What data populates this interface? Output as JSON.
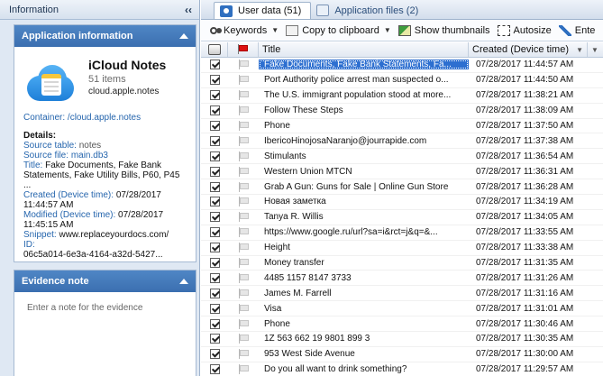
{
  "sidebar": {
    "header": "Information",
    "collapse_glyph": "‹‹",
    "app_panel_title": "Application information",
    "app_name": "iCloud Notes",
    "app_count": "51 items",
    "app_bundle": "cloud.apple.notes",
    "container_label": "Container:",
    "container_value": "/cloud.apple.notes",
    "details_heading": "Details:",
    "source_table_label": "Source table:",
    "source_table_value": "notes",
    "source_file_label": "Source file:",
    "source_file_value": "main.db3",
    "title_label": "Title:",
    "title_value": "Fake Documents, Fake Bank Statements, Fake Utility Bills, P60, P45 ...",
    "created_label": "Created (Device time):",
    "created_value": "07/28/2017 11:44:57 AM",
    "modified_label": "Modified (Device time):",
    "modified_value": "07/28/2017 11:45:15 AM",
    "snippet_label": "Snippet:",
    "snippet_value": "www.replaceyourdocs.com/",
    "id_label": "ID:",
    "id_value": "06c5a014-6e3a-4164-a32d-5427...",
    "evidence_title": "Evidence note",
    "evidence_placeholder": "Enter a note for the evidence"
  },
  "tabs": [
    {
      "label": "User data (51)",
      "active": true
    },
    {
      "label": "Application files (2)",
      "active": false
    }
  ],
  "toolbar": {
    "keywords": "Keywords",
    "copy": "Copy to clipboard",
    "thumbnails": "Show thumbnails",
    "autosize": "Autosize",
    "enter": "Ente"
  },
  "table": {
    "col_title": "Title",
    "col_created": "Created (Device time)",
    "rows": [
      {
        "title": "Fake Documents, Fake Bank Statements, Fa...",
        "created": "07/28/2017 11:44:57 AM",
        "selected": true
      },
      {
        "title": "Port Authority police arrest man suspected o...",
        "created": "07/28/2017 11:44:50 AM"
      },
      {
        "title": "The U.S. immigrant population stood at more...",
        "created": "07/28/2017 11:38:21 AM"
      },
      {
        "title": "Follow These Steps",
        "created": "07/28/2017 11:38:09 AM"
      },
      {
        "title": "Phone",
        "created": "07/28/2017 11:37:50 AM"
      },
      {
        "title": "IbericoHinojosaNaranjo@jourrapide.com",
        "created": "07/28/2017 11:37:38 AM"
      },
      {
        "title": "Stimulants",
        "created": "07/28/2017 11:36:54 AM"
      },
      {
        "title": "Western Union MTCN",
        "created": "07/28/2017 11:36:31 AM"
      },
      {
        "title": "Grab A Gun: Guns for Sale | Online Gun Store",
        "created": "07/28/2017 11:36:28 AM"
      },
      {
        "title": "Новая заметка",
        "created": "07/28/2017 11:34:19 AM"
      },
      {
        "title": "Tanya R. Willis",
        "created": "07/28/2017 11:34:05 AM"
      },
      {
        "title": "https://www.google.ru/url?sa=i&rct=j&q=&...",
        "created": "07/28/2017 11:33:55 AM"
      },
      {
        "title": "Height",
        "created": "07/28/2017 11:33:38 AM"
      },
      {
        "title": "Money transfer",
        "created": "07/28/2017 11:31:35 AM"
      },
      {
        "title": "4485 1157 8147 3733",
        "created": "07/28/2017 11:31:26 AM"
      },
      {
        "title": "James M. Farrell",
        "created": "07/28/2017 11:31:16 AM"
      },
      {
        "title": "Visa",
        "created": "07/28/2017 11:31:01 AM"
      },
      {
        "title": "Phone",
        "created": "07/28/2017 11:30:46 AM"
      },
      {
        "title": "1Z 563 662 19 9801 899 3",
        "created": "07/28/2017 11:30:35 AM"
      },
      {
        "title": "953 West Side Avenue",
        "created": "07/28/2017 11:30:00 AM"
      },
      {
        "title": "Do you all want to drink something?",
        "created": "07/28/2017 11:29:57 AM"
      }
    ]
  },
  "colors": {
    "accent": "#3b6fb0",
    "selection": "#2d6fd0",
    "flag_red": "#dd1111"
  }
}
